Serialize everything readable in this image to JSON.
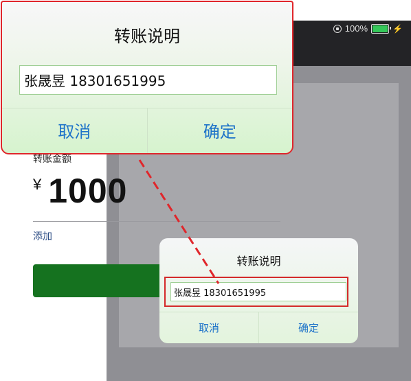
{
  "status_bar": {
    "battery_text": "100%",
    "charge_symbol": "⚡"
  },
  "transfer": {
    "amount_label": "转账金额",
    "currency_symbol": "¥",
    "amount": "1000",
    "add_note_label": "添加"
  },
  "dialog": {
    "title": "转账说明",
    "note_value": "张晟昱 18301651995",
    "cancel_label": "取消",
    "confirm_label": "确定"
  },
  "zoom": {
    "title": "转账说明",
    "note_value": "张晟昱 18301651995",
    "cancel_label": "取消",
    "confirm_label": "确定"
  },
  "colors": {
    "accent_blue": "#1e73c9",
    "highlight_red": "#e0262b",
    "confirm_green": "#15721f"
  },
  "icons": [
    "screen-rotation-lock-icon",
    "battery-icon",
    "charging-icon"
  ]
}
